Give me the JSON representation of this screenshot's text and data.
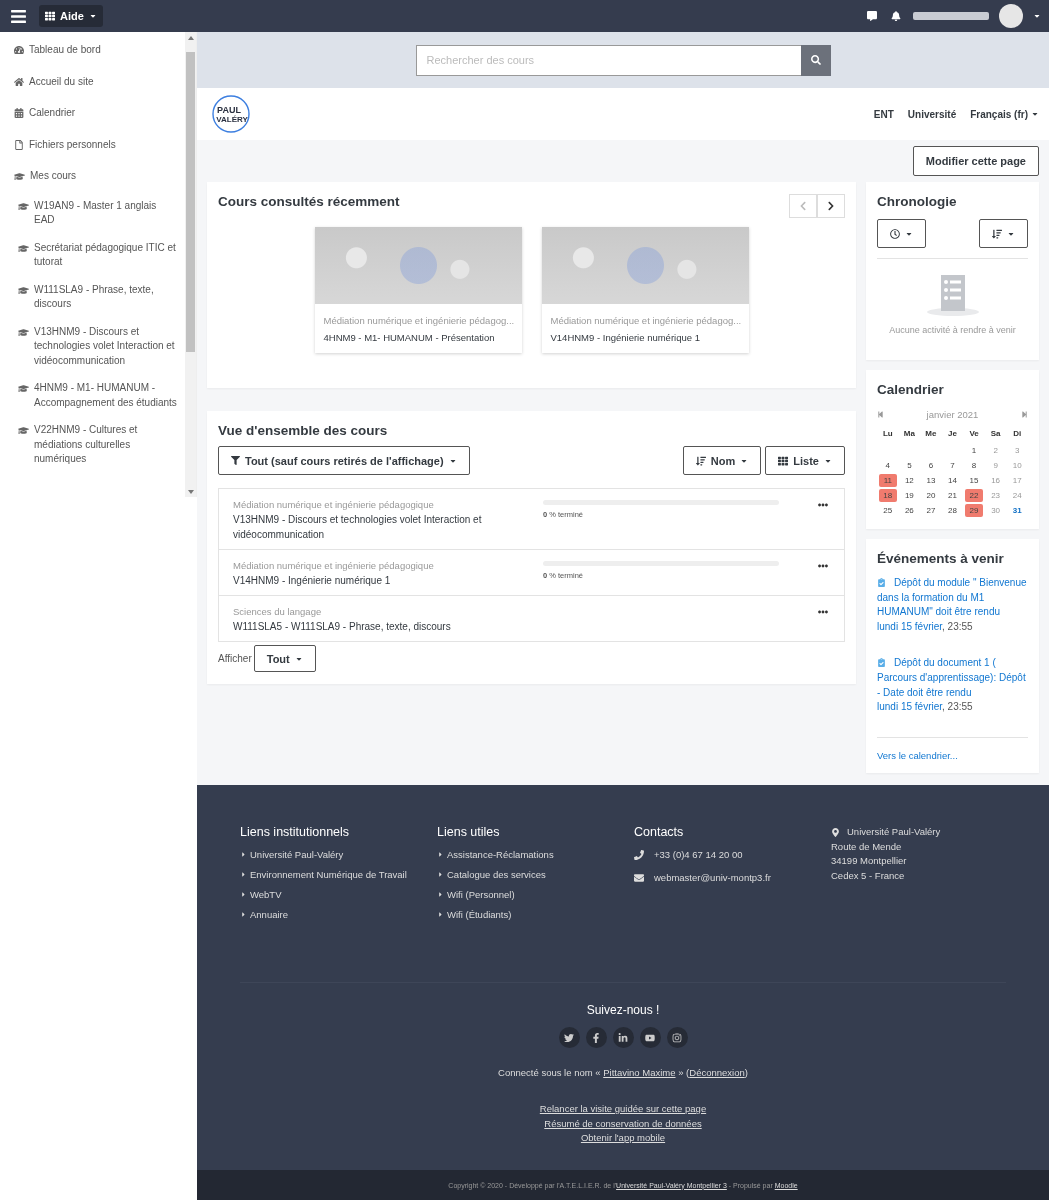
{
  "navbar": {
    "menu_label": "Aide"
  },
  "sidebar": {
    "items": [
      {
        "kind": "dashboard",
        "label": "Tableau de bord"
      },
      {
        "kind": "home",
        "label": "Accueil du site"
      },
      {
        "kind": "calendar",
        "label": "Calendrier"
      },
      {
        "kind": "file",
        "label": "Fichiers personnels"
      },
      {
        "kind": "course",
        "label": "Mes cours",
        "children": [
          {
            "kind": "course",
            "label": "W19AN9 - Master 1 anglais EAD"
          },
          {
            "kind": "course",
            "label": "Secrétariat pédagogique ITIC et tutorat"
          },
          {
            "kind": "course",
            "label": "W111SLA9 - Phrase, texte, discours"
          },
          {
            "kind": "course",
            "label": "V13HNM9 - Discours et technologies volet Interaction et vidéocommunication"
          },
          {
            "kind": "course",
            "label": "4HNM9 - M1- HUMANUM - Accompagnement des étudiants"
          },
          {
            "kind": "course",
            "label": "V22HNM9 - Cultures et médiations culturelles numériques"
          }
        ]
      }
    ]
  },
  "search": {
    "placeholder": "Rechercher des cours"
  },
  "header": {
    "logo_lines": [
      "PAUL",
      "VALÉRY"
    ],
    "links": [
      "ENT",
      "Université",
      "Français (fr)"
    ]
  },
  "edit_button": "Modifier cette page",
  "recent": {
    "title": "Cours consultés récemment",
    "cards": [
      {
        "category": "Médiation numérique et ingénierie pédagog...",
        "name": "4HNM9 - M1- HUMANUM - Présentation"
      },
      {
        "category": "Médiation numérique et ingénierie pédagog...",
        "name": "V14HNM9 - Ingénierie numérique 1"
      }
    ]
  },
  "overview": {
    "title": "Vue d'ensemble des cours",
    "filter": "Tout (sauf cours retirés de l'affichage)",
    "sort": "Nom",
    "view": "Liste",
    "courses": [
      {
        "category": "Médiation numérique et ingénierie pédagogique",
        "name": "V13HNM9 - Discours et technologies volet Interaction et vidéocommunication",
        "progress": "**0** % terminé",
        "level": 0
      },
      {
        "category": "Médiation numérique et ingénierie pédagogique",
        "name": "V14HNM9 - Ingénierie numérique 1",
        "progress": "**0** % terminé",
        "level": 0
      },
      {
        "category": "Sciences du langage",
        "name": "W111SLA5 - W111SLA9 - Phrase, texte, discours"
      }
    ],
    "show_label": "Afficher",
    "show_value": "Tout"
  },
  "timeline": {
    "title": "Chronologie",
    "empty": "Aucune activité à rendre à venir"
  },
  "calendar": {
    "title": "Calendrier",
    "month": "janvier 2021",
    "weekdays": [
      "Lu",
      "Ma",
      "Me",
      "Je",
      "Ve",
      "Sa",
      "Di"
    ],
    "weeks": [
      [
        {
          "d": "1",
          "event": false,
          "today": false
        },
        {
          "d": "2",
          "event": false,
          "today": false
        },
        {
          "d": "3",
          "event": false,
          "today": false
        }
      ],
      [
        {
          "d": "4",
          "event": false,
          "today": false
        },
        {
          "d": "5",
          "event": false,
          "today": false
        },
        {
          "d": "6",
          "event": false,
          "today": false
        },
        {
          "d": "7",
          "event": false,
          "today": false
        },
        {
          "d": "8",
          "event": false,
          "today": false
        },
        {
          "d": "9",
          "event": false,
          "today": false
        },
        {
          "d": "10",
          "event": false,
          "today": false
        }
      ],
      [
        {
          "d": "11",
          "event": true,
          "today": false
        },
        {
          "d": "12",
          "event": false,
          "today": false
        },
        {
          "d": "13",
          "event": false,
          "today": false
        },
        {
          "d": "14",
          "event": false,
          "today": false
        },
        {
          "d": "15",
          "event": false,
          "today": false
        },
        {
          "d": "16",
          "event": false,
          "today": false
        },
        {
          "d": "17",
          "event": false,
          "today": false
        }
      ],
      [
        {
          "d": "18",
          "event": true,
          "today": false
        },
        {
          "d": "19",
          "event": false,
          "today": false
        },
        {
          "d": "20",
          "event": false,
          "today": false
        },
        {
          "d": "21",
          "event": false,
          "today": false
        },
        {
          "d": "22",
          "event": true,
          "today": false
        },
        {
          "d": "23",
          "event": false,
          "today": false
        },
        {
          "d": "24",
          "event": false,
          "today": false
        }
      ],
      [
        {
          "d": "25",
          "event": false,
          "today": false
        },
        {
          "d": "26",
          "event": false,
          "today": false
        },
        {
          "d": "27",
          "event": false,
          "today": false
        },
        {
          "d": "28",
          "event": false,
          "today": false
        },
        {
          "d": "29",
          "event": true,
          "today": false
        },
        {
          "d": "30",
          "event": false,
          "today": false
        },
        {
          "d": "31",
          "event": false,
          "today": true
        }
      ]
    ]
  },
  "events": {
    "title": "Événements à venir",
    "items": [
      {
        "title": "Dépôt du module \" Bienvenue dans la formation du M1 HUMANUM\" doit être rendu",
        "date": "lundi 15 février",
        "time": ", 23:55"
      },
      {
        "title": "Dépôt du document 1 ( Parcours d'apprentissage): Dépôt - Date doit être rendu",
        "date": "lundi 15 février",
        "time": ", 23:55"
      }
    ],
    "more": "Vers le calendrier..."
  },
  "footer": {
    "columns": [
      {
        "title": "Liens institutionnels",
        "links": [
          "Université Paul-Valéry",
          "Environnement Numérique de Travail",
          "WebTV",
          "Annuaire"
        ]
      },
      {
        "title": "Liens utiles",
        "links": [
          "Assistance-Réclamations",
          "Catalogue des services",
          "Wifi (Personnel)",
          "Wifi (Étudiants)"
        ]
      }
    ],
    "contacts": {
      "title": "Contacts",
      "items": [
        {
          "kind": "phone",
          "text": "+33 (0)4 67 14 20 00"
        },
        {
          "kind": "email",
          "text": "webmaster@univ-montp3.fr"
        }
      ]
    },
    "address": [
      "Université Paul-Valéry",
      "Route de Mende",
      "34199 Montpellier",
      "Cedex 5 - France"
    ],
    "follow": "Suivez-nous !",
    "social": [
      {
        "kind": "twitter"
      },
      {
        "kind": "facebook"
      },
      {
        "kind": "linkedin"
      },
      {
        "kind": "youtube"
      },
      {
        "kind": "instagram"
      }
    ],
    "logged": [
      {
        "kind": "text",
        "text": "Connecté sous le nom « "
      },
      {
        "kind": "link",
        "text": "Pittavino Maxime"
      },
      {
        "kind": "text",
        "text": " » ("
      },
      {
        "kind": "link",
        "text": "Déconnexion"
      },
      {
        "kind": "text",
        "text": ")"
      }
    ],
    "links": [
      "Relancer la visite guidée sur cette page",
      "Résumé de conservation de données",
      "Obtenir l'app mobile"
    ],
    "copyright": [
      {
        "kind": "text",
        "text": "Copyright © 2020 - Développé par l'A.T.E.L.I.E.R. de l'"
      },
      {
        "kind": "link",
        "text": "Université Paul-Valéry Montpellier 3"
      },
      {
        "kind": "text",
        "text": " - Propulsé par "
      },
      {
        "kind": "link",
        "text": "Moodle"
      }
    ]
  }
}
